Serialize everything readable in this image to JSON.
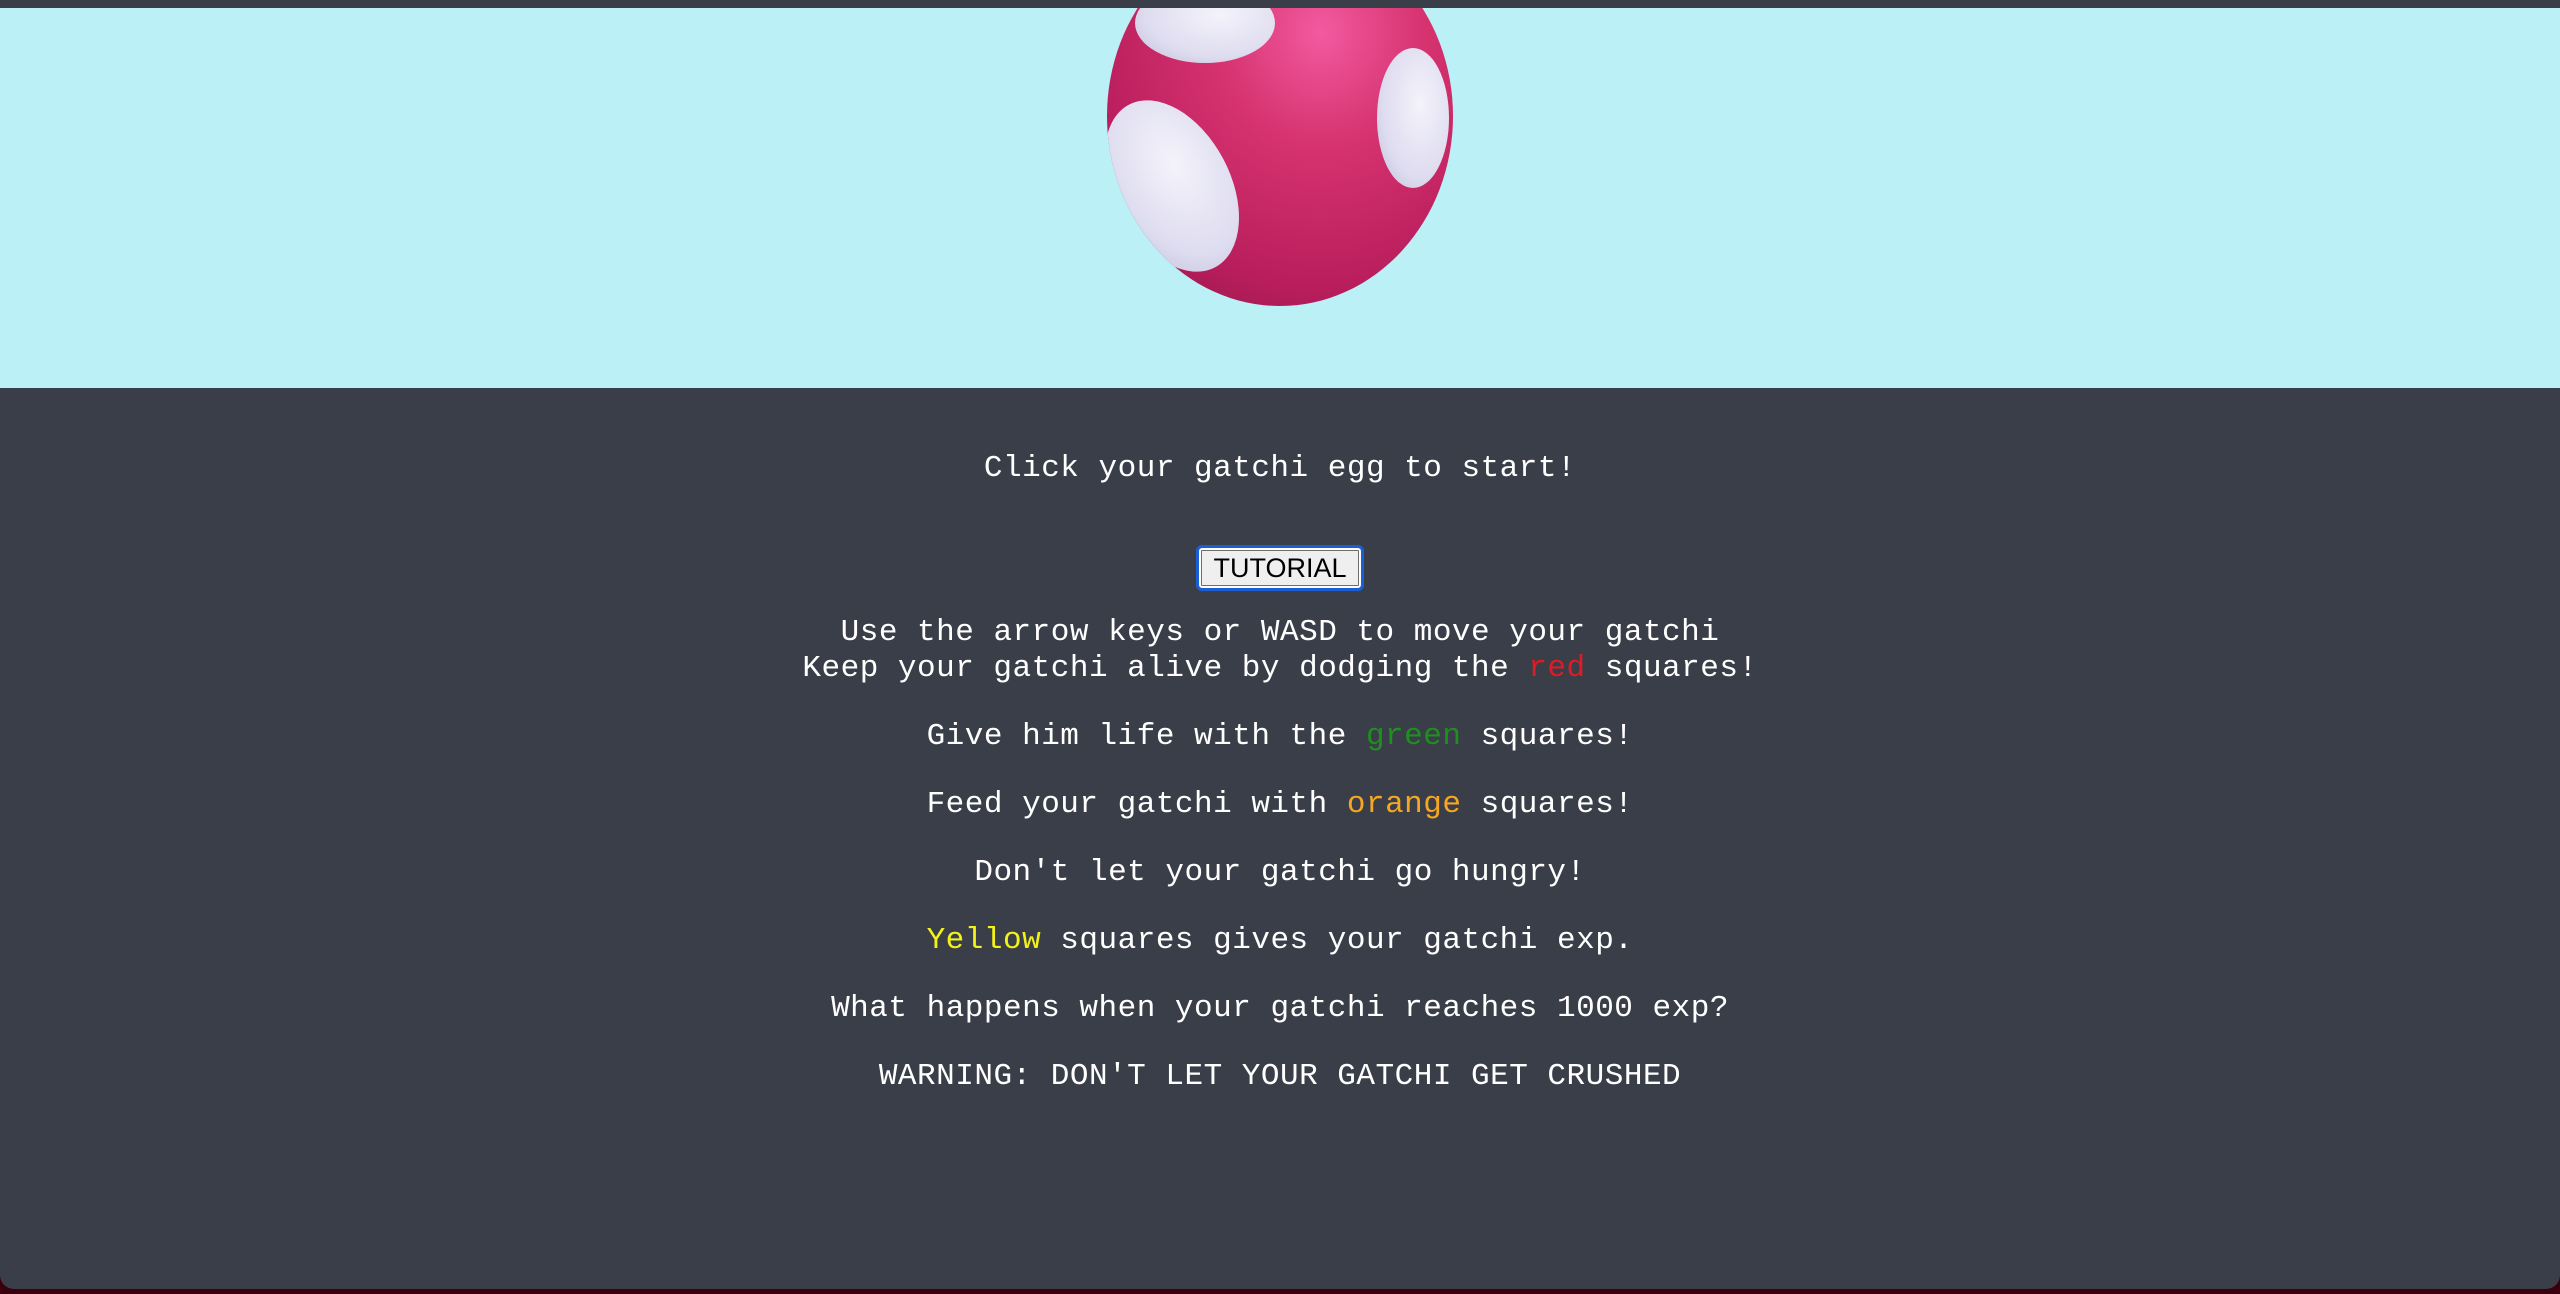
{
  "intro": {
    "start_prompt": "Click your gatchi egg to start!",
    "tutorial_button": "TUTORIAL"
  },
  "tutorial": {
    "move": "Use the arrow keys or WASD to move your gatchi",
    "dodge_prefix": "Keep your gatchi alive by dodging the ",
    "dodge_color_word": "red",
    "dodge_suffix": " squares!",
    "life_prefix": "Give him life with the ",
    "life_color_word": "green",
    "life_suffix": " squares!",
    "feed_prefix": "Feed your gatchi with ",
    "feed_color_word": "orange",
    "feed_suffix": " squares!",
    "hungry": "Don't let your gatchi go hungry!",
    "exp_color_word": "Yellow",
    "exp_suffix": " squares gives your gatchi exp.",
    "question": "What happens when your gatchi reaches 1000 exp?",
    "warning": "WARNING: DON'T LET YOUR GATCHI GET CRUSHED"
  },
  "colors": {
    "sky": "#bbf0f7",
    "panel": "#3a3e48",
    "egg": "#d6336f",
    "egg_spots": "#e8e6f5",
    "red": "#e01b24",
    "green": "#1f8f1f",
    "orange": "#f5a623",
    "yellow": "#f2f21a"
  },
  "icons": {
    "egg": "gatchi-egg-icon"
  }
}
